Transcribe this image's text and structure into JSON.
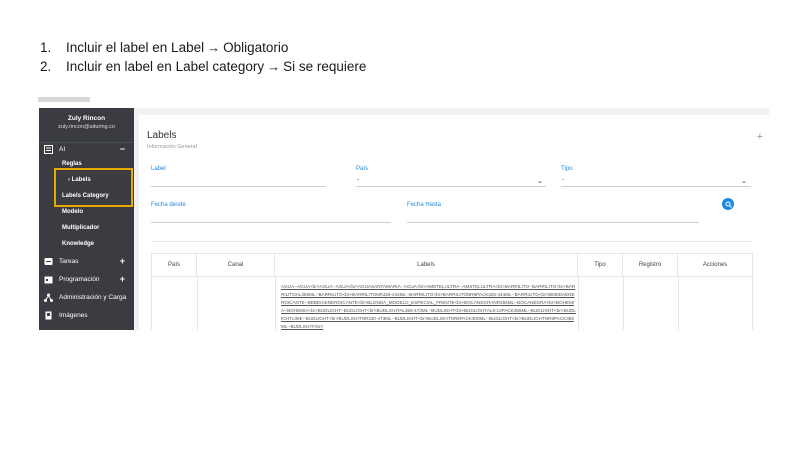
{
  "instructions": [
    {
      "num": "1.",
      "before": "Incluir el label en Label",
      "after": "Obligatorio"
    },
    {
      "num": "2.",
      "before": "Incluir en label en Label category",
      "after": "Si se requiere"
    }
  ],
  "sidebar": {
    "user_name": "Zuly Rincon",
    "user_email": "zuly.rincon@aituring.co",
    "ai_label": "AI",
    "ai_sign": "−",
    "sub_items": [
      "Reglas",
      "Labels",
      "Labels Category",
      "Modelo",
      "Multiplicador",
      "Knowledge"
    ],
    "items": [
      {
        "label": "Tareas",
        "sign": "+"
      },
      {
        "label": "Programación",
        "sign": "+"
      },
      {
        "label": "Administración y Carga",
        "sign": ""
      },
      {
        "label": "Imágenes",
        "sign": ""
      }
    ]
  },
  "main": {
    "title": "Labels",
    "subtitle": "Información General",
    "plus": "+",
    "filters": {
      "label": "Label",
      "pais": "País",
      "pais_value": "-",
      "tipo": "Tipo",
      "tipo_value": "-",
      "fecha_desde": "Fecha desde",
      "fecha_hasta": "Fecha Hasta"
    },
    "table": {
      "headers": [
        "País",
        "Canal",
        "Labels",
        "Tipo",
        "Registro",
        "Acciones"
      ],
      "row_labels": "AGUA--AGUA<br>AGUA--AGUA<br>AGUASANTAMARIA--AGUA<br>AMSTELULTRA--AMSTELULTRA<br>BARRILITO--BARRILITO<br>BARRILITOAL355ML--BARRILITO<br>BARRILITONR325-444ML--BARRILITO<br>BARRILITONR6PACK325-444ML--BARRILITO<br>BEBIDAENERGICANTE--BEBIDAENERGICANTE<br>BLONDA_MODELO_ESPECIAL_FRENTE<br>BOCANEGRANR355ML--BOCANEGRA<br>BOHEMIA--BOHEMIA<br>BUDLIGHT--BUDLIGHT<br>BUDLIGHTAL355-473ML--BUDLIGHT<br>BUDLIGHTAL6-12PACK355ML--BUDLIGHT<br>BUDLIGHTLIME--BUDLIGHT<br>BUDLIGHTNR330-473ML--BUDLIGHT<br>BUDLIGHTNR6PACK300ML--BUDLIGHT<br>BUDLIGHTNR6PACK355ML--BUDLIGHT<br>"
    }
  }
}
